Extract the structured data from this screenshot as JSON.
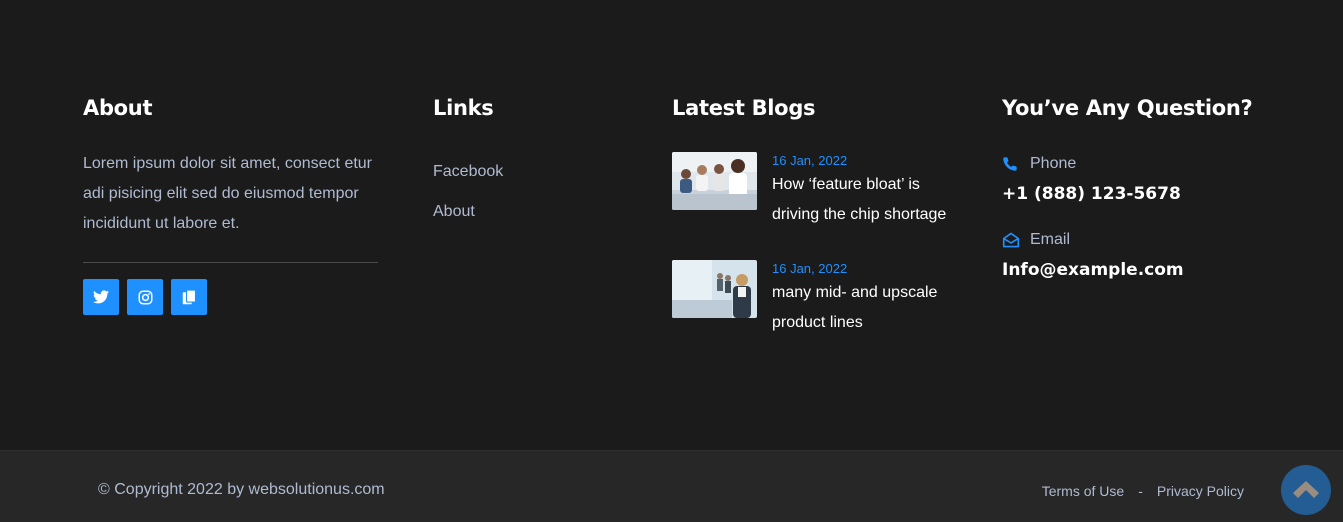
{
  "about": {
    "title": "About",
    "text": "Lorem ipsum dolor sit amet, consect etur adi pisicing elit sed do eiusmod tempor incididunt ut labore et.",
    "socials": [
      {
        "icon": "twitter-icon"
      },
      {
        "icon": "instagram-icon"
      },
      {
        "icon": "copy-icon"
      }
    ]
  },
  "links": {
    "title": "Links",
    "items": [
      "Facebook",
      "About"
    ]
  },
  "blogs": {
    "title": "Latest Blogs",
    "items": [
      {
        "date": "16 Jan, 2022",
        "title": "How ‘feature bloat’ is driving the chip shortage"
      },
      {
        "date": "16 Jan, 2022",
        "title": "many mid- and upscale product lines"
      }
    ]
  },
  "contact": {
    "title": "You’ve Any Question?",
    "phone_label": "Phone",
    "phone_value": "+1 (888) 123-5678",
    "email_label": "Email",
    "email_value": "Info@example.com"
  },
  "bottom": {
    "copyright": "© Copyright 2022 by websolutionus.com",
    "terms": "Terms of Use",
    "separator": "-",
    "privacy": "Privacy Policy"
  },
  "colors": {
    "accent": "#1e90ff",
    "background": "#1c1b1c",
    "bottom_background": "#272727",
    "muted_text": "#aebbd1"
  }
}
